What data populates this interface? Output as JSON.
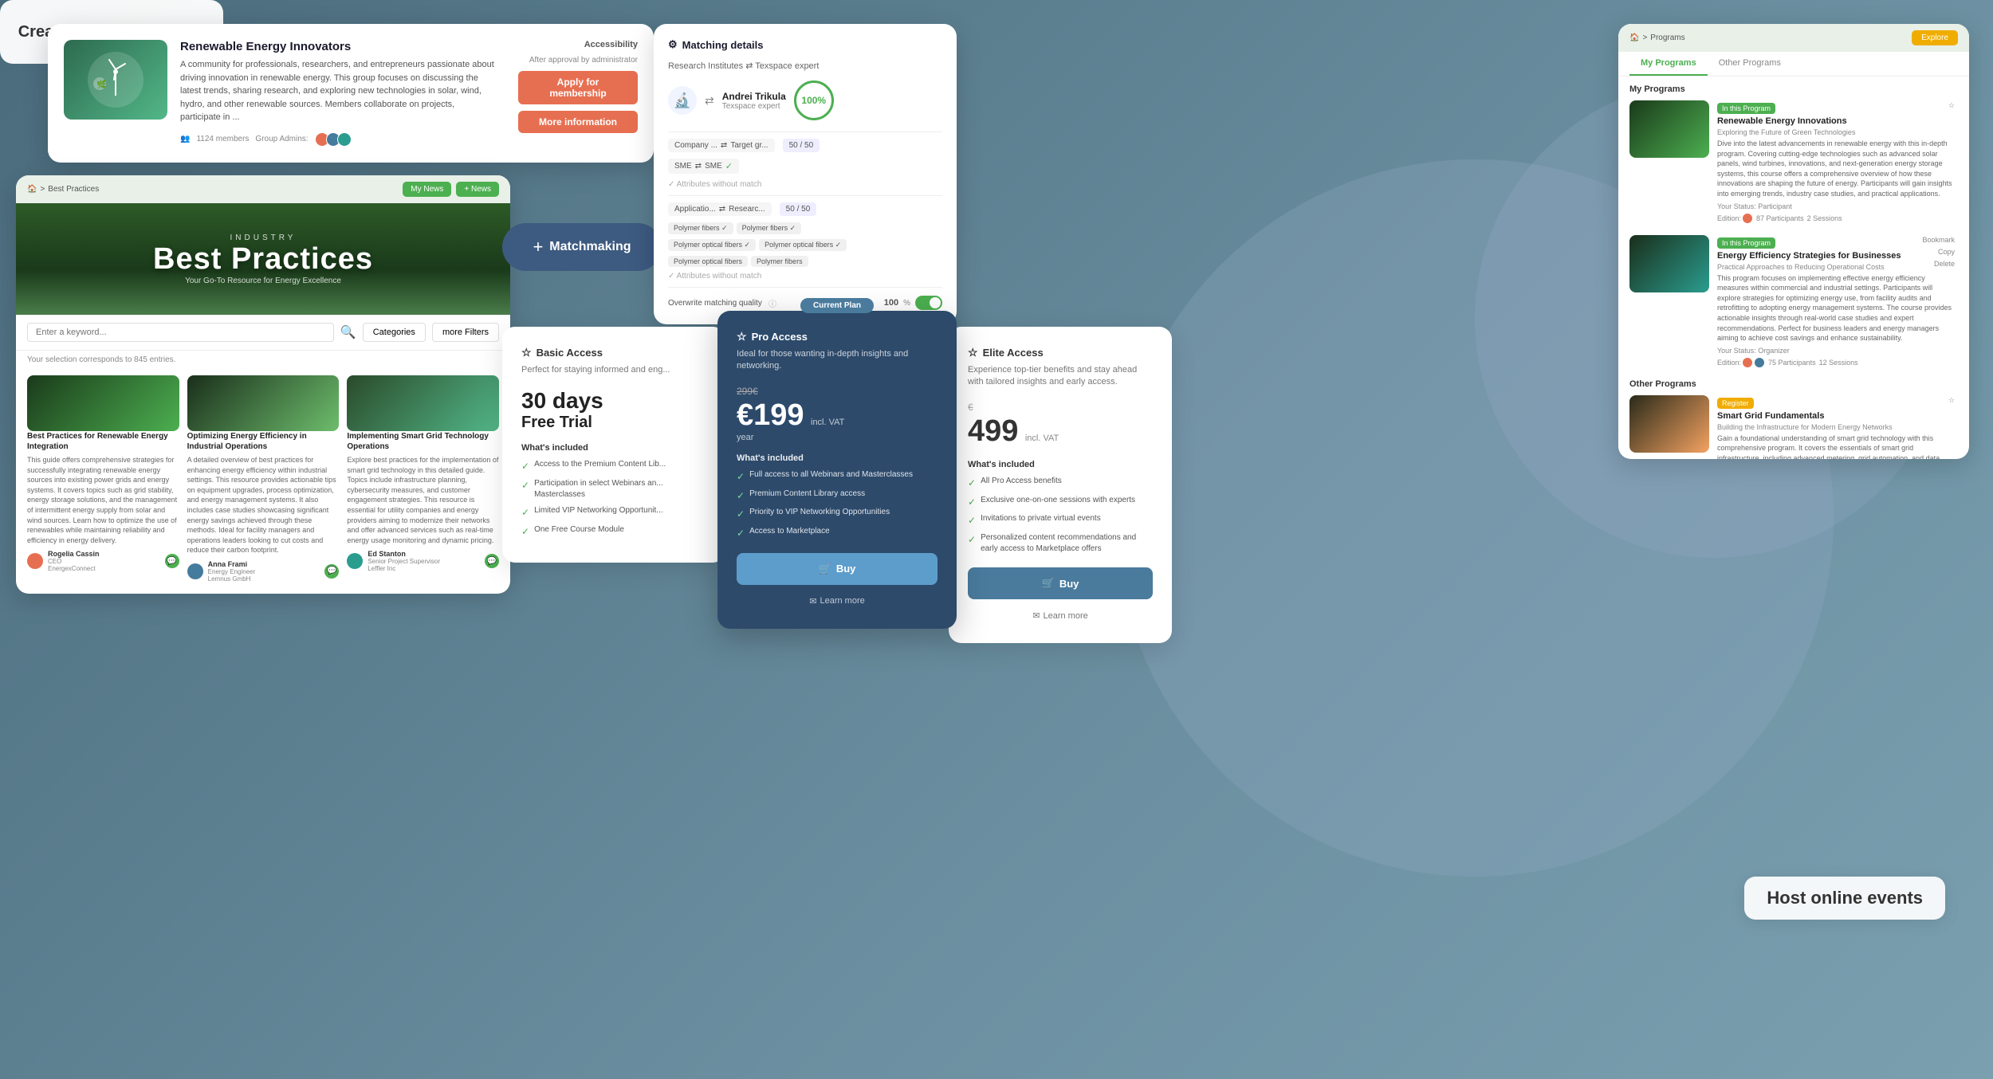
{
  "background": {
    "gradient": "linear-gradient(135deg, #4a6b7c, #7aa0b0)"
  },
  "community_card": {
    "title": "Renewable Energy Innovators",
    "description": "A community for professionals, researchers, and entrepreneurs passionate about driving innovation in renewable energy. This group focuses on discussing the latest trends, sharing research, and exploring new technologies in solar, wind, hydro, and other renewable sources. Members collaborate on projects, participate in ...",
    "members_count": "1124 members",
    "group_admins_label": "Group Admins:",
    "accessibility_label": "Accessibility",
    "accessibility_sub": "After approval by administrator",
    "apply_btn": "Apply for membership",
    "more_info_btn": "More information"
  },
  "best_practices": {
    "breadcrumb": "Best Practices",
    "my_news_btn": "My News",
    "news_btn": "+ News",
    "hero_subtitle": "INDUSTRY",
    "hero_title": "Best Practices",
    "hero_tagline": "Your Go-To Resource for Energy Excellence",
    "search_placeholder": "Enter a keyword...",
    "categories_label": "Categories",
    "more_filters_label": "more Filters",
    "results_info": "Your selection corresponds to 845 entries.",
    "articles": [
      {
        "title": "Best Practices for Renewable Energy Integration",
        "description": "This guide offers comprehensive strategies for successfully integrating renewable energy sources into existing power grids and energy systems. It covers topics such as grid stability, energy storage solutions, and the management of intermittent energy supply from solar and wind sources. Learn how to optimize the use of renewables while maintaining reliability and efficiency in energy delivery.",
        "author_name": "Rogelia Cassin",
        "author_title": "CEO",
        "author_company": "EnergexConnect"
      },
      {
        "title": "Optimizing Energy Efficiency in Industrial Operations",
        "description": "A detailed overview of best practices for enhancing energy efficiency within industrial settings. This resource provides actionable tips on equipment upgrades, process optimization, and energy management systems. It also includes case studies showcasing significant energy savings achieved through these methods. Ideal for facility managers and operations leaders looking to cut costs and reduce their carbon footprint.",
        "author_name": "Anna Frami",
        "author_title": "Energy Engineer",
        "author_company": "Lemnus GmbH"
      },
      {
        "title": "Implementing Smart Grid Technology Operations",
        "description": "Explore best practices for the implementation of smart grid technology in this detailed guide. Topics include infrastructure planning, cybersecurity measures, and customer engagement strategies. This resource is essential for utility companies and energy providers aiming to modernize their networks and offer advanced services such as real-time energy usage monitoring and dynamic pricing.",
        "author_name": "Ed Stanton",
        "author_title": "Senior Project Supervisor",
        "author_company": "Leffler Inc"
      }
    ]
  },
  "matchmaking": {
    "button_label": "Matchmaking",
    "plus": "+"
  },
  "membership_tiers": {
    "label": "Create membership tiers"
  },
  "matching_details": {
    "title": "Matching details",
    "subtitle_left": "Research Institutes",
    "subtitle_right": "Texspace expert",
    "person_name": "Andrei Trikula",
    "person_role": "Texspace expert",
    "match_percent": "100%",
    "rows": [
      {
        "left": "Company ...",
        "right": "Target gr...",
        "score": "50 / 50"
      },
      {
        "left": "SME",
        "right": "SME",
        "check": true
      },
      {
        "left": "Attributes without match",
        "is_note": true
      },
      {
        "left": "Applicatio...",
        "right": "Researc...",
        "score": "50 / 50"
      },
      {
        "left": "Polymer fibers",
        "right": "Polymer fibers",
        "check": true
      },
      {
        "left": "Polymer optical fibers",
        "right": "Polymer optical fibers",
        "check": true
      },
      {
        "left": "Polymer optical fibers",
        "right": "Polymer fibers",
        "no_check": true
      },
      {
        "left": "Attributes without match",
        "is_note": true
      }
    ],
    "overwrite_label": "Overwrite matching quality",
    "quality_value": "100",
    "quality_unit": "%"
  },
  "host_events": {
    "label": "Host online events"
  },
  "programs": {
    "breadcrumb": "Programs",
    "explore_btn": "Explore",
    "tabs": [
      "My Programs",
      "Other Programs"
    ],
    "active_tab": "My Programs",
    "my_programs_label": "My Programs",
    "other_programs_label": "Other Programs",
    "my_items": [
      {
        "title": "Renewable Energy Innovations",
        "subtitle": "Exploring the Future of Green Technologies",
        "description": "Dive into the latest advancements in renewable energy with this in-depth program. Covering cutting-edge technologies such as advanced solar panels, wind turbines, innovations, and next-generation energy storage systems, this course offers a comprehensive overview of how these innovations are shaping the future of energy. Participants will gain insights into emerging trends, industry case studies, and practical applications.",
        "status": "Participant",
        "badge": "In this Program",
        "editor_label": "Edition:",
        "participants": "87 Participants",
        "sessions": "2 Sessions"
      },
      {
        "title": "Energy Efficiency Strategies for Businesses",
        "subtitle": "Practical Approaches to Reducing Operational Costs",
        "description": "This program focuses on implementing effective energy efficiency measures within commercial and industrial settings. Participants will explore strategies for optimizing energy use, from facility audits and retrofitting to adopting energy management systems. The course provides actionable insights through real-world case studies and expert recommendations. Perfect for business leaders and energy managers aiming to achieve cost savings and enhance sustainability.",
        "status": "Organizer",
        "badge": "In this Program",
        "editor_label": "Edition:",
        "participants": "75 Participants",
        "sessions": "12 Sessions"
      }
    ],
    "other_items": [
      {
        "title": "Smart Grid Fundamentals",
        "subtitle": "Building the Infrastructure for Modern Energy Networks",
        "description": "Gain a foundational understanding of smart grid technology with this comprehensive program. It covers the essentials of smart grid infrastructure, including advanced metering, grid automation, and data management. Participants will learn about the benefits and challenges of implementing smart grids, as well as key considerations for successful integration. This course is suited for utility professionals and...",
        "badge": "Register",
        "badge_color": "orange"
      }
    ]
  },
  "pricing": {
    "current_plan_label": "Current Plan",
    "plans": [
      {
        "id": "basic",
        "icon": "☆",
        "name": "Basic Access",
        "tagline": "Perfect for staying informed and eng...",
        "trial_days": "30 days",
        "trial_label": "Free Trial",
        "features": [
          "Access to the Premium Content Lib...",
          "Participation in select Webinars an... Masterclasses",
          "Limited VIP Networking Opportunit...",
          "One Free Course Module"
        ]
      },
      {
        "id": "pro",
        "icon": "☆",
        "name": "Pro Access",
        "tagline": "Ideal for those wanting in-depth insights and networking.",
        "price_old": "299€",
        "price": "€199",
        "price_suffix": "incl. VAT",
        "price_period": "year",
        "is_current": true,
        "features": [
          "Full access to all Webinars and Masterclasses",
          "Premium Content Library access",
          "Priority to VIP Networking Opportunities",
          "Access to Marketplace"
        ],
        "buy_btn": "Buy",
        "learn_more_btn": "Learn more"
      },
      {
        "id": "elite",
        "icon": "☆",
        "name": "Elite Access",
        "tagline": "Experience top-tier benefits and stay ahead with tailored insights and early access.",
        "price_old": "€",
        "price": "499",
        "price_suffix": "incl. VAT",
        "features": [
          "All Pro Access benefits",
          "Exclusive one-on-one sessions with experts",
          "Invitations to private virtual events",
          "Personalized content recommendations and early access to Marketplace offers"
        ],
        "buy_btn": "Buy",
        "learn_more_btn": "Learn more"
      }
    ]
  }
}
